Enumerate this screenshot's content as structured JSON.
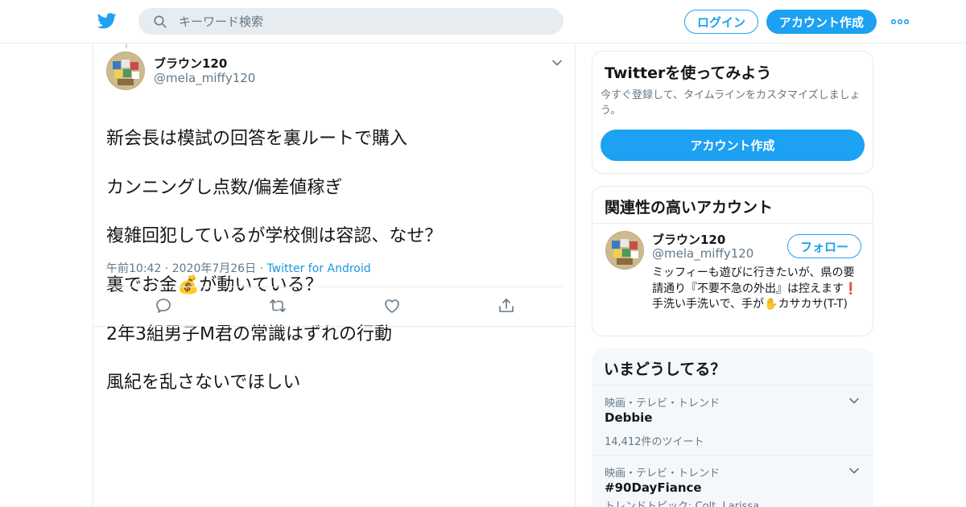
{
  "header": {
    "search_placeholder": "キーワード検索",
    "login_label": "ログイン",
    "signup_label": "アカウント作成"
  },
  "tweet": {
    "name": "ブラウン120",
    "handle": "@mela_miffy120",
    "text_lines": [
      "新会長は模試の回答を裏ルートで購入",
      "カンニングし点数/偏差値稼ぎ",
      "複雑回犯しているが学校側は容認、なせ？",
      "裏でお金💰が動いている？",
      "2年3組男子M君の常識はずれの行動",
      "風紀を乱さないでほしい"
    ],
    "time": "午前10:42",
    "date": "2020年7月26日",
    "source": "Twitter for Android"
  },
  "signup_card": {
    "title": "Twitterを使ってみよう",
    "description": "今すぐ登録して、タイムラインをカスタマイズしましょう。",
    "button_label": "アカウント作成"
  },
  "related_card": {
    "title": "関連性の高いアカウント",
    "name": "ブラウン120",
    "handle": "@mela_miffy120",
    "follow_label": "フォロー",
    "bio": "ミッフィーも遊びに行きたいが、県の要請通り『不要不急の外出』は控えます❗ 手洗い手洗いで、手が✋カサカサ(T-T)"
  },
  "trends_card": {
    "title": "いまどうしてる？",
    "items": [
      {
        "category": "映画・テレビ・トレンド",
        "name": "Debbie",
        "count": "14,412件のツイート"
      },
      {
        "category": "映画・テレビ・トレンド",
        "name": "#90DayFiance",
        "count": "トレンドトピック: Colt, Larissa"
      }
    ]
  },
  "colors": {
    "brand": "#1da1f2",
    "text": "#14171a",
    "muted": "#657786",
    "border": "#e6ecf0"
  },
  "icons": [
    "twitter-bird-icon",
    "search-icon",
    "more-icon",
    "chevron-down-icon",
    "reply-icon",
    "retweet-icon",
    "like-icon",
    "share-icon"
  ]
}
